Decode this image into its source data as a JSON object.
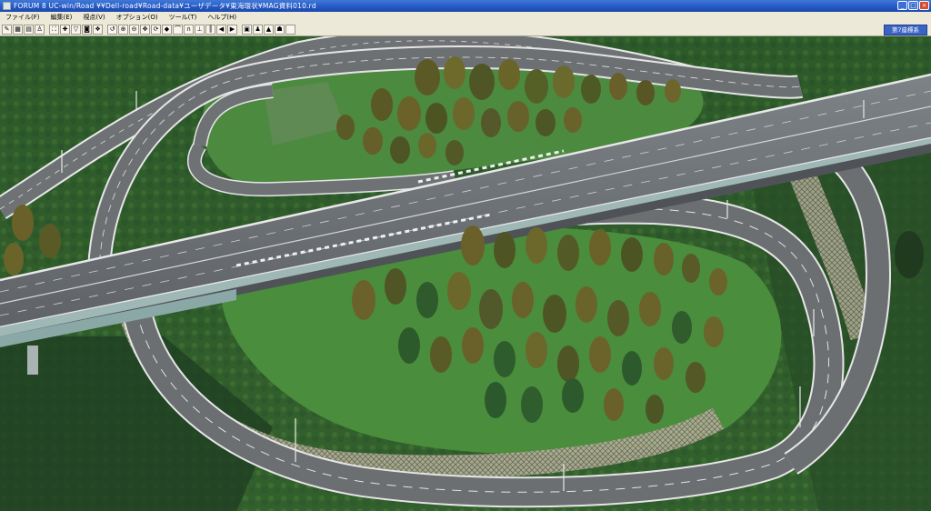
{
  "window": {
    "title": "FORUM 8    UC-win/Road    ¥¥Dell-road¥Road-data¥ユーザデータ¥東海環状¥MAG資料010.rd"
  },
  "menu": [
    {
      "label": "ファイル(F)"
    },
    {
      "label": "編集(E)"
    },
    {
      "label": "視点(V)"
    },
    {
      "label": "オプション(O)"
    },
    {
      "label": "ツール(T)"
    },
    {
      "label": "ヘルプ(H)"
    }
  ],
  "toolbar": {
    "mode_label": "第7座標系"
  },
  "icons": {
    "toolbar": [
      "pencil-icon",
      "terrain-icon",
      "grid-icon",
      "person-icon",
      "road-icon",
      "intersection-icon",
      "sign-icon",
      "car-icon",
      "palette-icon",
      "reset-icon",
      "zoom-in-icon",
      "zoom-out-icon",
      "pan-icon",
      "rotate-icon",
      "car-move-icon",
      "bridge-icon",
      "tunnel-icon",
      "pole-icon",
      "line-icon",
      "arrow-left-icon",
      "arrow-right-icon",
      "camera-icon",
      "walk-icon",
      "up-icon",
      "run-icon",
      "blank-icon"
    ]
  },
  "colors": {
    "titlebar": "#2358c4",
    "road": "#6f7274",
    "grass": "#3f7a3a",
    "tree": "#7a6a30"
  }
}
